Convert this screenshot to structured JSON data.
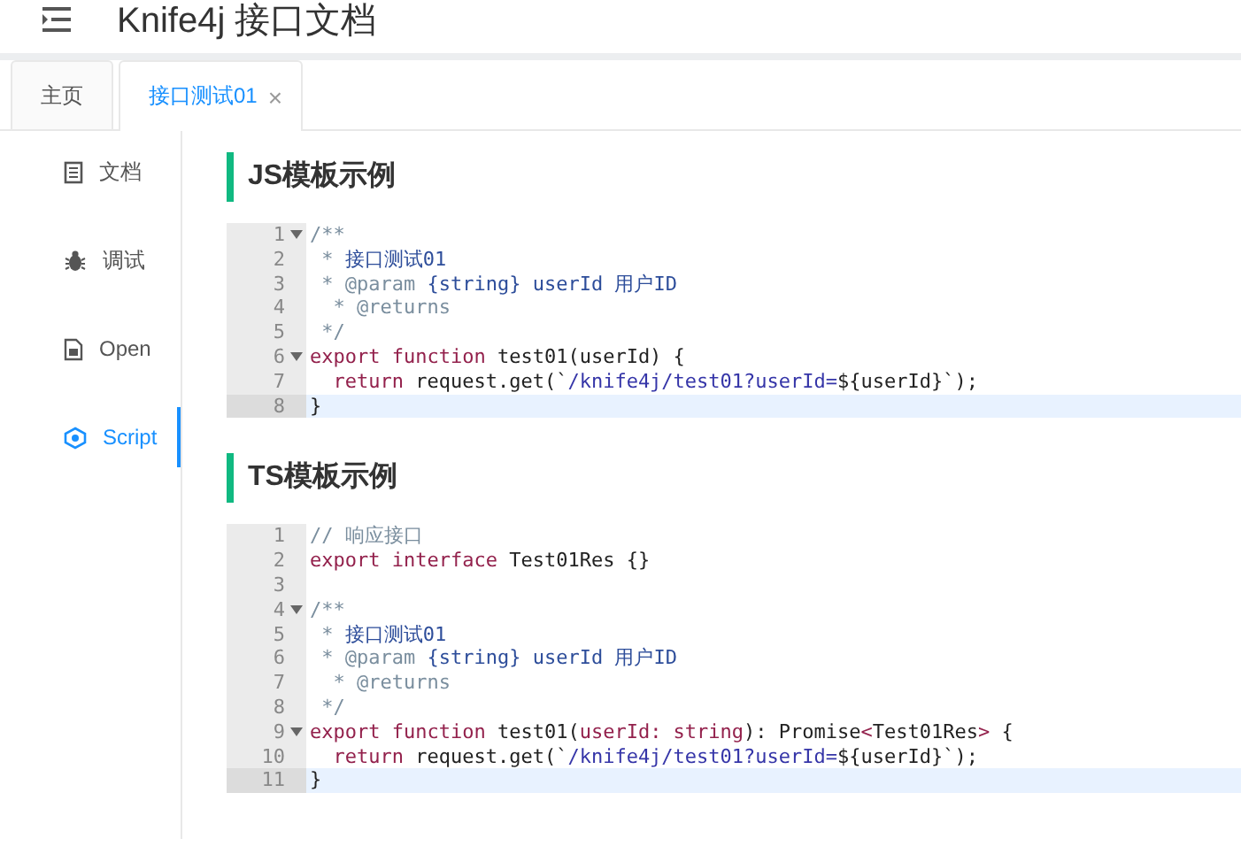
{
  "header": {
    "title": "Knife4j 接口文档"
  },
  "tabs": [
    {
      "label": "主页",
      "selected": false
    },
    {
      "label": "接口测试01",
      "selected": true,
      "close": "×"
    }
  ],
  "sidebar": {
    "items": [
      {
        "label": "文档",
        "selected": false
      },
      {
        "label": "调试",
        "selected": false
      },
      {
        "label": "Open",
        "selected": false
      },
      {
        "label": "Script",
        "selected": true
      }
    ]
  },
  "sections": [
    {
      "title": "JS模板示例",
      "lines": [
        {
          "n": "1",
          "fold": true,
          "active": false,
          "tokens": [
            {
              "kind": "comment",
              "t": "/**"
            }
          ]
        },
        {
          "n": "2",
          "fold": false,
          "active": false,
          "tokens": [
            {
              "kind": "comment",
              "t": " * "
            },
            {
              "kind": "doc",
              "t": "接口测试01"
            }
          ]
        },
        {
          "n": "3",
          "fold": false,
          "active": false,
          "tokens": [
            {
              "kind": "comment",
              "t": " * @param "
            },
            {
              "kind": "doc",
              "t": "{string} userId 用户ID"
            }
          ]
        },
        {
          "n": "4",
          "fold": false,
          "active": false,
          "tokens": [
            {
              "kind": "comment",
              "t": "  * @returns"
            }
          ]
        },
        {
          "n": "5",
          "fold": false,
          "active": false,
          "tokens": [
            {
              "kind": "comment",
              "t": " */"
            }
          ]
        },
        {
          "n": "6",
          "fold": true,
          "active": false,
          "tokens": [
            {
              "kind": "keyword",
              "t": "export function "
            },
            {
              "kind": "plain",
              "t": "test01(userId) {"
            }
          ]
        },
        {
          "n": "7",
          "fold": false,
          "active": false,
          "tokens": [
            {
              "kind": "keyword",
              "t": "  return "
            },
            {
              "kind": "plain",
              "t": "request.get(`"
            },
            {
              "kind": "string",
              "t": "/knife4j/test01?userId="
            },
            {
              "kind": "plain",
              "t": "${userId}`);"
            }
          ]
        },
        {
          "n": "8",
          "fold": false,
          "active": true,
          "tokens": [
            {
              "kind": "plain",
              "t": "}"
            }
          ]
        }
      ]
    },
    {
      "title": "TS模板示例",
      "lines": [
        {
          "n": "1",
          "fold": false,
          "active": false,
          "tokens": [
            {
              "kind": "comment",
              "t": "// 响应接口"
            }
          ]
        },
        {
          "n": "2",
          "fold": false,
          "active": false,
          "tokens": [
            {
              "kind": "keyword",
              "t": "export interface "
            },
            {
              "kind": "plain",
              "t": "Test01Res {}"
            }
          ]
        },
        {
          "n": "3",
          "fold": false,
          "active": false
        },
        {
          "n": "4",
          "fold": true,
          "active": false,
          "tokens": [
            {
              "kind": "comment",
              "t": "/**"
            }
          ]
        },
        {
          "n": "5",
          "fold": false,
          "active": false,
          "tokens": [
            {
              "kind": "comment",
              "t": " * "
            },
            {
              "kind": "doc",
              "t": "接口测试01"
            }
          ]
        },
        {
          "n": "6",
          "fold": false,
          "active": false,
          "tokens": [
            {
              "kind": "comment",
              "t": " * @param "
            },
            {
              "kind": "doc",
              "t": "{string} userId 用户ID"
            }
          ]
        },
        {
          "n": "7",
          "fold": false,
          "active": false,
          "tokens": [
            {
              "kind": "comment",
              "t": "  * @returns"
            }
          ]
        },
        {
          "n": "8",
          "fold": false,
          "active": false,
          "tokens": [
            {
              "kind": "comment",
              "t": " */"
            }
          ]
        },
        {
          "n": "9",
          "fold": true,
          "active": false,
          "tokens": [
            {
              "kind": "keyword",
              "t": "export function "
            },
            {
              "kind": "plain",
              "t": "test01("
            },
            {
              "kind": "keyword",
              "t": "userId: string"
            },
            {
              "kind": "plain",
              "t": "): Promise"
            },
            {
              "kind": "keyword",
              "t": "<"
            },
            {
              "kind": "plain",
              "t": "Test01Res"
            },
            {
              "kind": "keyword",
              "t": ">"
            },
            {
              "kind": "plain",
              "t": " {"
            }
          ]
        },
        {
          "n": "10",
          "fold": false,
          "active": false,
          "tokens": [
            {
              "kind": "keyword",
              "t": "  return "
            },
            {
              "kind": "plain",
              "t": "request.get(`"
            },
            {
              "kind": "string",
              "t": "/knife4j/test01?userId="
            },
            {
              "kind": "plain",
              "t": "${userId}`);"
            }
          ]
        },
        {
          "n": "11",
          "fold": false,
          "active": true,
          "tokens": [
            {
              "kind": "plain",
              "t": "}"
            }
          ]
        }
      ]
    }
  ]
}
